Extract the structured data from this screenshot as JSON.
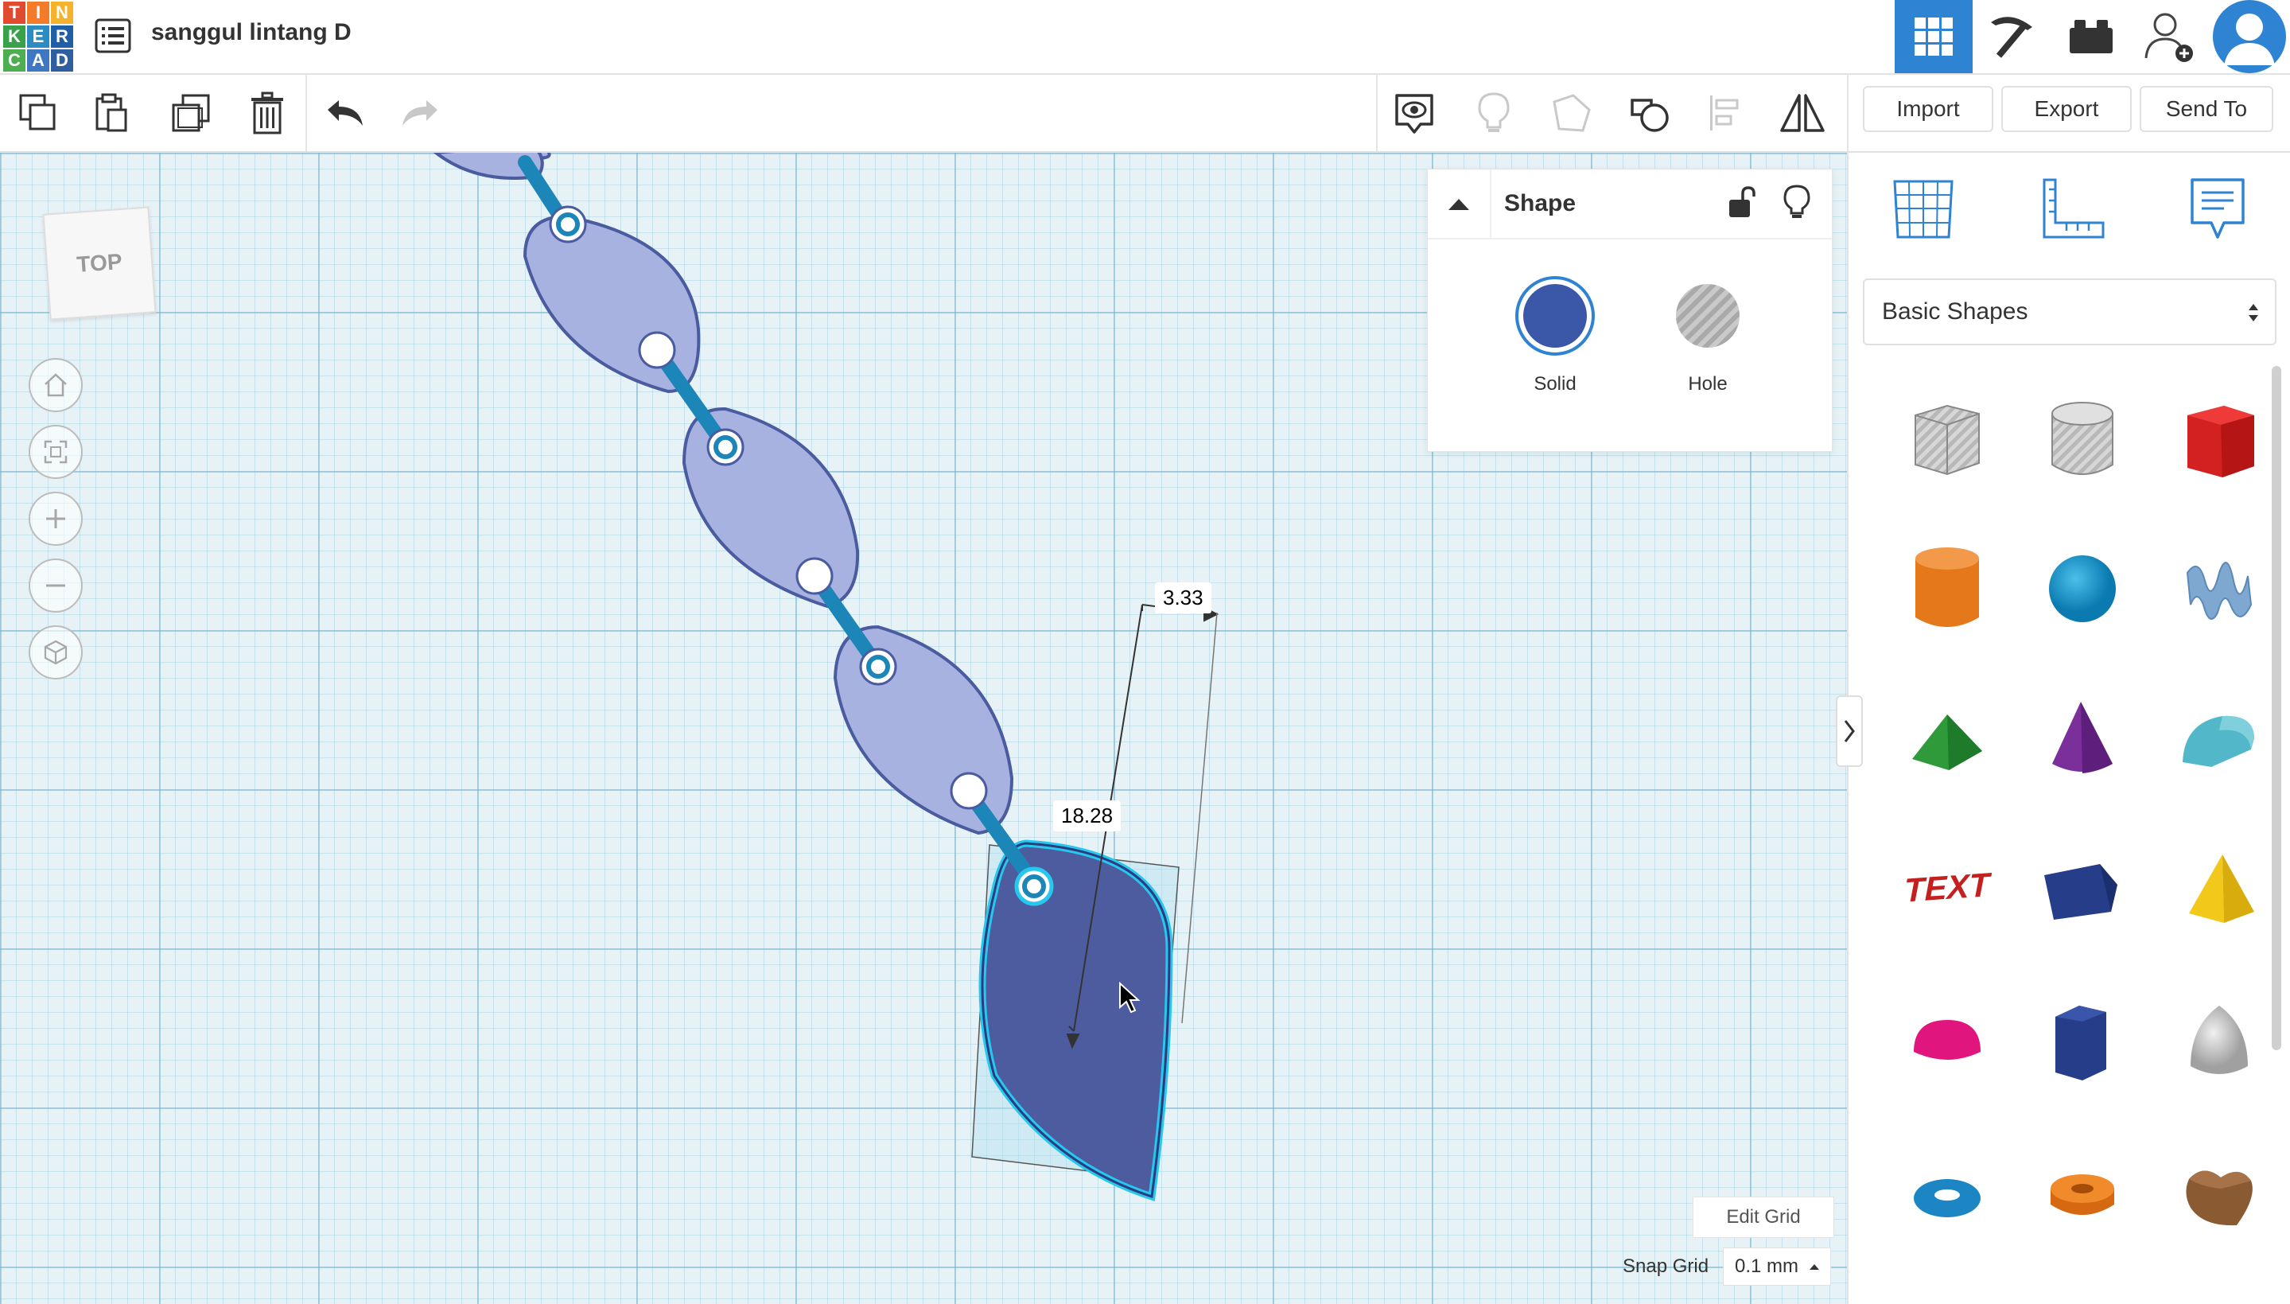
{
  "app": {
    "logo_letters": [
      "T",
      "I",
      "N",
      "K",
      "E",
      "R",
      "C",
      "A",
      "D"
    ],
    "logo_colors": [
      "#e04a2f",
      "#f47b2a",
      "#f4b32a",
      "#37a249",
      "#2b8cc4",
      "#1f5fa6",
      "#4caf50",
      "#3e78c2",
      "#2f5f9e"
    ],
    "title": "sanggul lintang D"
  },
  "top_icons": [
    "grid-view-icon",
    "pickaxe-icon",
    "bricks-icon",
    "add-user-icon",
    "user-avatar-icon"
  ],
  "toolbar": {
    "import_label": "Import",
    "export_label": "Export",
    "send_to_label": "Send To"
  },
  "viewcube": {
    "label": "TOP"
  },
  "shape_panel": {
    "title": "Shape",
    "solid_label": "Solid",
    "hole_label": "Hole",
    "solid_color": "#3b57a8"
  },
  "dimensions": {
    "width": "3.33",
    "length": "18.28"
  },
  "library": {
    "category": "Basic Shapes",
    "text_shape_label": "TEXT",
    "shapes": [
      "box-hole",
      "cylinder-hole",
      "box",
      "cylinder",
      "sphere",
      "scribble",
      "roof",
      "cone",
      "round-roof",
      "text",
      "wedge-prism",
      "pyramid",
      "half-sphere",
      "polygon",
      "paraboloid",
      "torus",
      "tube",
      "heart"
    ]
  },
  "footer": {
    "edit_grid": "Edit Grid",
    "snap_grid_label": "Snap Grid",
    "snap_grid_value": "0.1 mm"
  },
  "colors": {
    "accent_blue": "#2f83d3",
    "leaf_light": "#a8b2e0",
    "leaf_dark": "#4a5ba0",
    "rod": "#1c86b8",
    "selection": "#27c8ee"
  }
}
